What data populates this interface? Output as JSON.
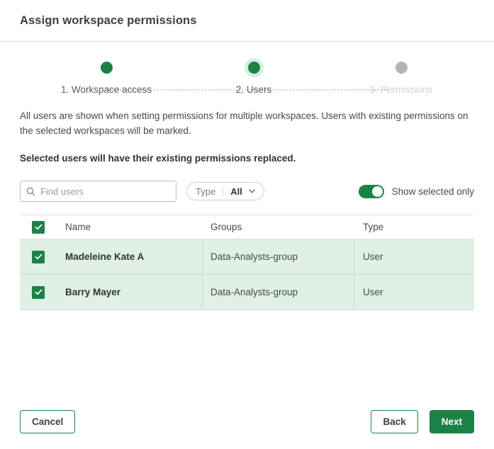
{
  "header": {
    "title": "Assign workspace permissions"
  },
  "stepper": {
    "steps": [
      {
        "label": "1. Workspace access",
        "state": "complete",
        "dot": "step-dot-complete"
      },
      {
        "label": "2. Users",
        "state": "active",
        "dot": "step-dot-active"
      },
      {
        "label": "3. Permissions",
        "state": "inactive",
        "dot": "step-dot-inactive"
      }
    ]
  },
  "body": {
    "intro": "All users are shown when setting permissions for multiple workspaces. Users with existing permissions on the selected workspaces will be marked.",
    "notice": "Selected users will have their existing permissions replaced."
  },
  "filters": {
    "search": {
      "placeholder": "Find users",
      "value": "",
      "icon": "search-icon"
    },
    "type_filter": {
      "label": "Type",
      "value": "All",
      "icon": "chevron-down-icon"
    },
    "show_selected_toggle": {
      "label": "Show selected only",
      "state": "on"
    }
  },
  "table": {
    "select_all_checked": true,
    "columns": [
      "Name",
      "Groups",
      "Type"
    ],
    "rows": [
      {
        "checked": true,
        "name": "Madeleine Kate A",
        "groups": "Data-Analysts-group",
        "type": "User"
      },
      {
        "checked": true,
        "name": "Barry Mayer",
        "groups": "Data-Analysts-group",
        "type": "User"
      }
    ]
  },
  "footer": {
    "cancel_label": "Cancel",
    "back_label": "Back",
    "next_label": "Next"
  },
  "colors": {
    "accent_green": "#1a8245",
    "row_selected_bg": "#dff0e4",
    "active_halo": "#d5efdd",
    "inactive_gray": "#b4b4b4",
    "text_primary": "#404040",
    "text_muted": "#cfcfcf"
  }
}
